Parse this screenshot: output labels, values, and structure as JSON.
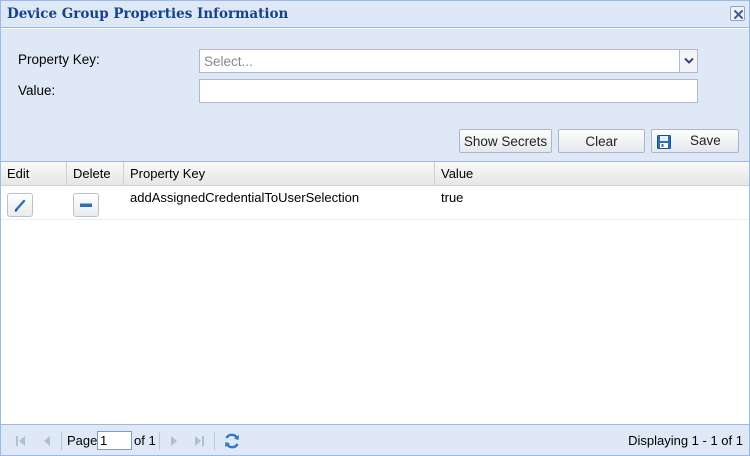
{
  "window": {
    "title": "Device Group Properties Information",
    "close_icon": "close-icon"
  },
  "form": {
    "property_key_label": "Property Key:",
    "property_key_placeholder": "Select...",
    "property_key_value": "",
    "value_label": "Value:",
    "value_value": ""
  },
  "toolbar": {
    "show_secrets_label": "Show Secrets",
    "clear_label": "Clear",
    "save_label": "Save"
  },
  "grid": {
    "columns": [
      "Edit",
      "Delete",
      "Property Key",
      "Value"
    ],
    "rows": [
      {
        "edit_icon": "pencil-icon",
        "delete_icon": "minus-icon",
        "key": "addAssignedCredentialToUserSelection",
        "value": "true"
      }
    ]
  },
  "paging": {
    "page_label": "Page",
    "page_value": "1",
    "of_label": "of 1",
    "display_message": "Displaying 1 - 1 of 1"
  },
  "colors": {
    "title_text": "#15428b",
    "panel_bg": "#dfe8f6",
    "border": "#99bbe8"
  }
}
